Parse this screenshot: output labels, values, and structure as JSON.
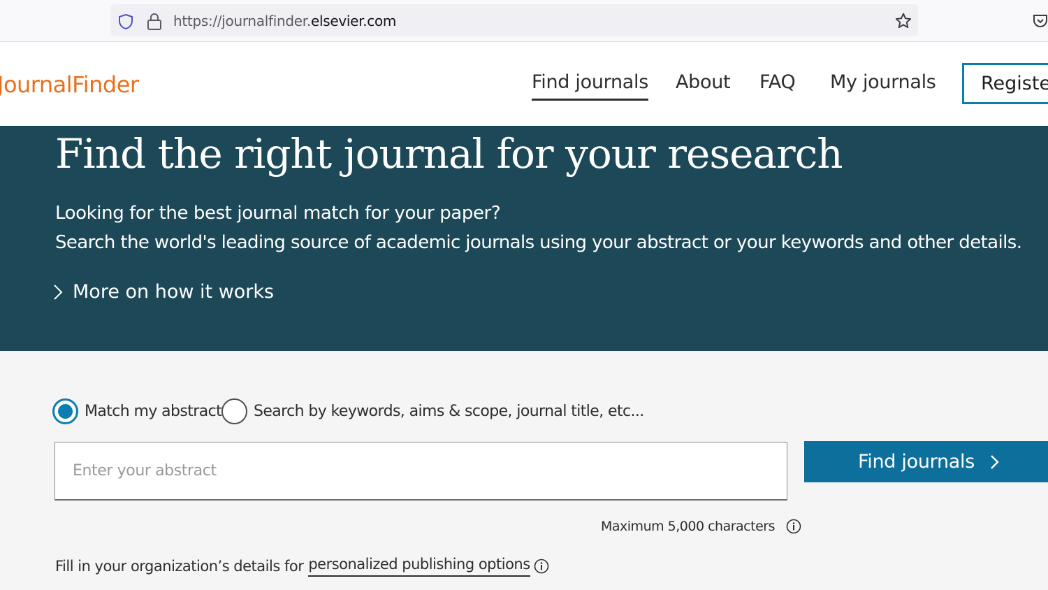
{
  "browser": {
    "url_prefix": "https://journalfinder.",
    "url_host": "elsevier.com",
    "icons": [
      "shield-icon",
      "lock-icon",
      "star-icon",
      "pocket-icon"
    ]
  },
  "header": {
    "logo": "JournalFinder",
    "nav": {
      "find_journals": "Find journals",
      "about": "About",
      "faq": "FAQ",
      "my_journals": "My journals"
    },
    "register": "Register"
  },
  "hero": {
    "title": "Find the right journal for your research",
    "line1": "Looking for the best journal match for your paper?",
    "line2": "Search the world's leading source of academic journals using your abstract or your keywords and other details.",
    "more_link": "More on how it works"
  },
  "search": {
    "mode_options": [
      {
        "label": "Match my abstract",
        "selected": true
      },
      {
        "label": "Search by keywords, aims & scope, journal title, etc...",
        "selected": false
      }
    ],
    "abstract_value": "",
    "abstract_placeholder": "Enter your abstract",
    "submit_label": "Find journals",
    "max_chars": "Maximum 5,000 characters",
    "org_prefix": "Fill in your organization’s details for",
    "org_link": "personalized publishing options"
  },
  "colors": {
    "hero_bg": "#1c4857",
    "logo": "#e9711c",
    "accent": "#0c7db0",
    "button": "#0c6f9c",
    "page_bg": "#f5f5f5"
  }
}
